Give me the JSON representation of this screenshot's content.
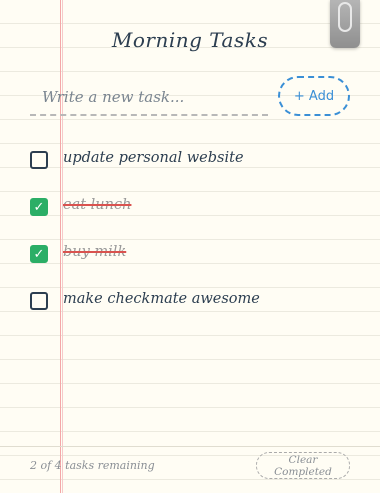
{
  "app": {
    "title": "Morning Tasks"
  },
  "input": {
    "placeholder": "Write a new task...",
    "value": ""
  },
  "add_button": {
    "label": "+ Add"
  },
  "tasks": [
    {
      "text": "update personal website",
      "done": false
    },
    {
      "text": "eat lunch",
      "done": true
    },
    {
      "text": "buy milk",
      "done": true
    },
    {
      "text": "make checkmate awesome",
      "done": false
    }
  ],
  "footer": {
    "remaining": "2 of 4 tasks remaining",
    "clear_label": "Clear Completed"
  },
  "colors": {
    "accent": "#3a8fd6",
    "check": "#2bae66",
    "strike": "#d9534f",
    "margin": "#f3a8a8"
  }
}
